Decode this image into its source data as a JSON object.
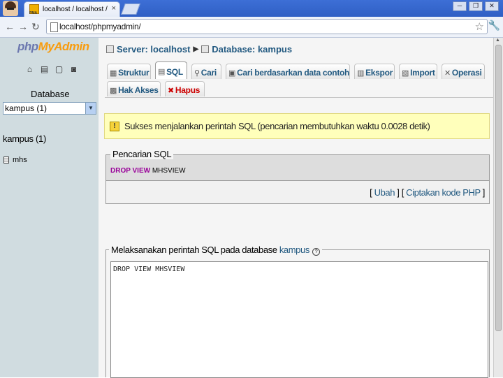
{
  "browser": {
    "tab_title": "localhost / localhost / kampus",
    "tab_close": "×",
    "favicon_text": "PMA",
    "url": "localhost/phpmyadmin/",
    "window_controls": [
      "─",
      "❐",
      "✕"
    ]
  },
  "nav": {
    "logo_php": "php",
    "logo_myadmin": "MyAdmin",
    "database_label": "Database",
    "db_select_value": "kampus (1)",
    "db_name": "kampus (1)",
    "tables": [
      "mhs"
    ]
  },
  "breadcrumb": {
    "server": "Server: localhost",
    "database": "Database: kampus"
  },
  "tabs": [
    {
      "label": "Struktur",
      "icon": "structure-icon"
    },
    {
      "label": "SQL",
      "icon": "sql-icon",
      "active": true
    },
    {
      "label": "Cari",
      "icon": "search-icon"
    },
    {
      "label": "Cari berdasarkan data contoh",
      "icon": "query-icon"
    },
    {
      "label": "Ekspor",
      "icon": "export-icon"
    },
    {
      "label": "Import",
      "icon": "import-icon"
    },
    {
      "label": "Operasi",
      "icon": "operations-icon"
    },
    {
      "label": "Hak Akses",
      "icon": "privileges-icon"
    },
    {
      "label": "Hapus",
      "icon": "drop-icon",
      "danger": true
    }
  ],
  "success_message": "Sukses menjalankan perintah SQL (pencarian membutuhkan waktu 0.0028 detik)",
  "sql_box": {
    "legend": "Pencarian SQL",
    "query_keyword": "DROP VIEW",
    "query_rest": " MHSVIEW",
    "open_bracket": "[",
    "edit_link": "Ubah",
    "middle": "] [",
    "php_link": "Ciptakan kode PHP",
    "close_bracket": "]"
  },
  "run_box": {
    "legend_prefix": "Melaksanakan perintah SQL pada database ",
    "legend_db": "kampus",
    "help_glyph": "?",
    "textarea_value": "DROP VIEW MHSVIEW"
  },
  "colors": {
    "link": "#235a81",
    "danger": "#cc0000",
    "sql_keyword": "#990099",
    "success_bg": "#ffffbb"
  }
}
